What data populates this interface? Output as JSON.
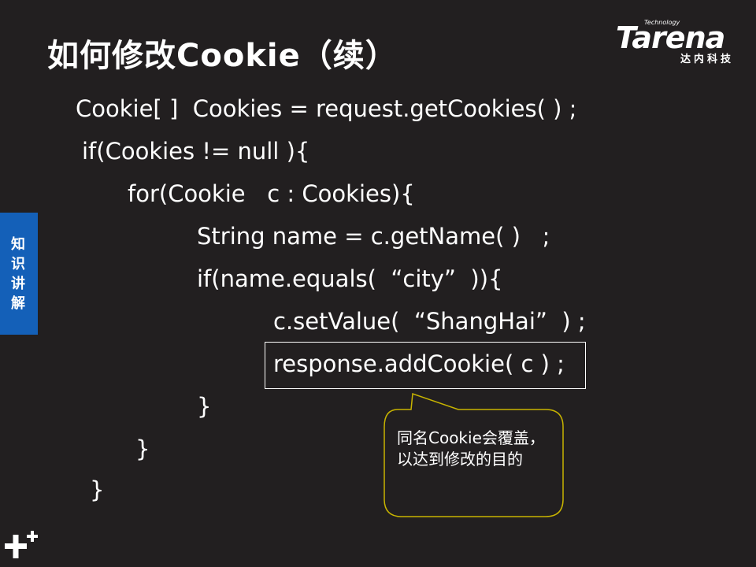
{
  "title": "如何修改Cookie（续）",
  "logo": {
    "technology": "Technology",
    "brand": "Tarena",
    "subtitle": "达内科技"
  },
  "side_tab": "知识讲解",
  "code": [
    "Cookie[ ]  Cookies = request.getCookies( ) ;",
    "if(Cookies != null ){",
    "for(Cookie   c : Cookies){",
    "String name = c.getName( )   ;",
    "if(name.equals(  “city”  )){",
    "c.setValue(  “ShangHai”  ) ;",
    "response.addCookie( c ) ;",
    "}",
    "}",
    "}"
  ],
  "callout": "同名Cookie会覆盖，以达到修改的目的",
  "colors": {
    "background": "#221f20",
    "side_tab": "#1460b8",
    "callout_border": "#c8b400"
  },
  "icons": {
    "plus": "plus-plus-icon"
  }
}
